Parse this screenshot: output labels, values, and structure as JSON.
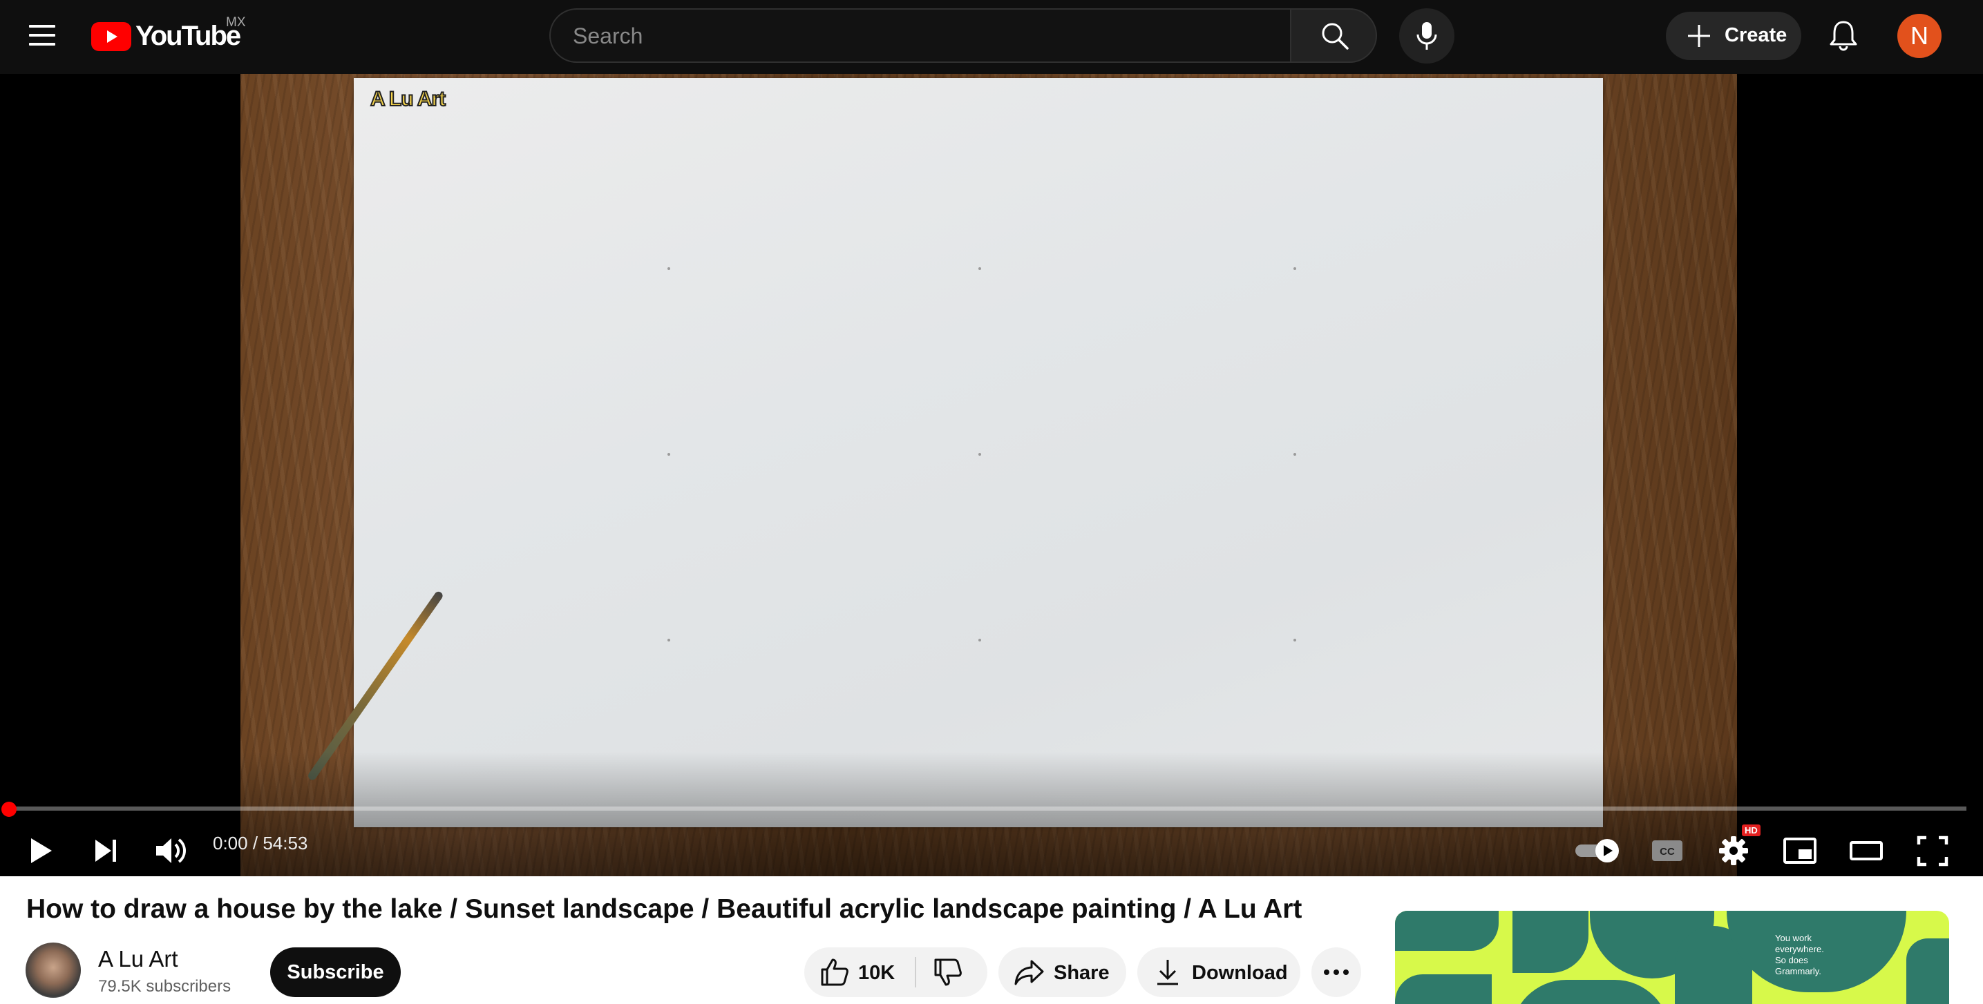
{
  "header": {
    "logo_text": "YouTube",
    "country_code": "MX",
    "search_placeholder": "Search",
    "create_label": "Create",
    "account_initial": "N"
  },
  "player": {
    "watermark": "A Lu Art",
    "time_current": "0:00",
    "time_separator": "/",
    "time_total": "54:53",
    "progress_fraction": 0,
    "hd_badge": "HD",
    "accent_color": "#ff0000",
    "icons": [
      "play-icon",
      "next-icon",
      "volume-icon",
      "autoplay-toggle",
      "captions-icon",
      "settings-icon",
      "miniplayer-icon",
      "theater-icon",
      "fullscreen-icon"
    ]
  },
  "video": {
    "title": "How to draw a house by the lake / Sunset landscape / Beautiful acrylic landscape painting / A Lu Art",
    "channel_name": "A Lu Art",
    "subscriber_count": "79.5K subscribers",
    "subscribe_label": "Subscribe",
    "like_count": "10K",
    "share_label": "Share",
    "download_label": "Download"
  },
  "ad": {
    "text": "You work everywhere. So does Grammarly.",
    "background_color": "#d7f94a",
    "shape_color": "#2f7a6a"
  }
}
